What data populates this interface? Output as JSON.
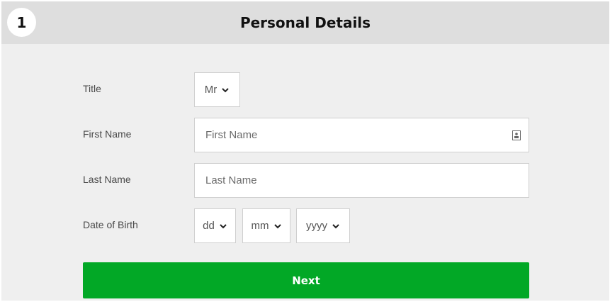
{
  "step": {
    "number": "1",
    "title": "Personal Details"
  },
  "form": {
    "title": {
      "label": "Title",
      "value": "Mr"
    },
    "first_name": {
      "label": "First Name",
      "placeholder": "First Name"
    },
    "last_name": {
      "label": "Last Name",
      "placeholder": "Last Name"
    },
    "dob": {
      "label": "Date of Birth",
      "day": "dd",
      "month": "mm",
      "year": "yyyy"
    }
  },
  "next_button": {
    "label": "Next"
  },
  "colors": {
    "accent": "#02a826",
    "header_bg": "#dedede",
    "panel_bg": "#efefef"
  },
  "icons": {
    "autofill": "contact-card-icon",
    "caret": "chevron-down-icon"
  }
}
